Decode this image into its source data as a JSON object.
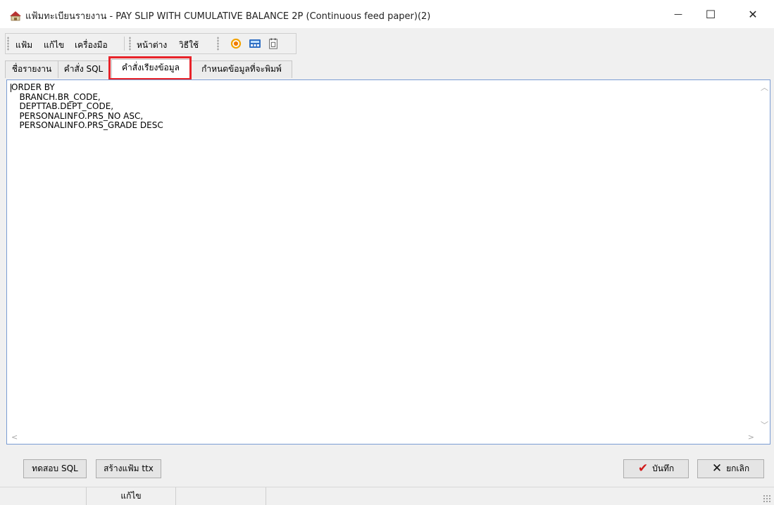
{
  "window": {
    "title": "แฟ้มทะเบียนรายงาน - PAY SLIP WITH CUMULATIVE BALANCE 2P (Continuous feed paper)(2)",
    "minimize_glyph": "—",
    "maximize_glyph": "☐",
    "close_glyph": "✕"
  },
  "menu": {
    "file": "แฟ้ม",
    "edit": "แก้ไข",
    "tools": "เครื่องมือ",
    "window": "หน้าต่าง",
    "help": "วิธีใช้"
  },
  "toolbar_icons": [
    "target-icon",
    "calculator-icon",
    "calendar-icon"
  ],
  "tabs": {
    "report_name": "ชื่อรายงาน",
    "sql_command": "คำสั่ง SQL",
    "sort_command": "คำสั่งเรียงข้อมูล",
    "print_fields": "กำหนดข้อมูลที่จะพิมพ์"
  },
  "editor": {
    "content": "ORDER BY\n   BRANCH.BR_CODE,\n   DEPTTAB.DEPT_CODE,\n   PERSONALINFO.PRS_NO ASC,\n   PERSONALINFO.PRS_GRADE DESC"
  },
  "buttons": {
    "test_sql": "ทดสอบ SQL",
    "create_ttx": "สร้างแฟ้ม ttx",
    "save": "บันทึก",
    "cancel": "ยกเลิก"
  },
  "status": {
    "mode": "แก้ไข"
  },
  "colors": {
    "tab_highlight": "#e8232a",
    "save_check": "#d11a1a",
    "editor_border": "#7a9cd3"
  }
}
